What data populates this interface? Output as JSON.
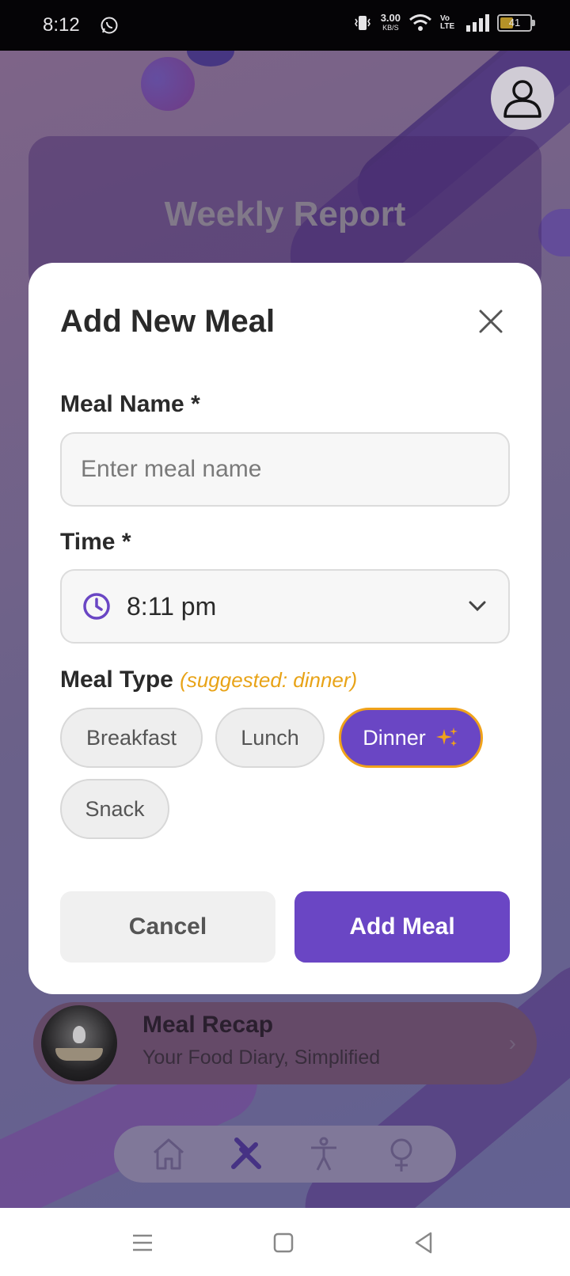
{
  "status_bar": {
    "time": "8:12",
    "net_speed": "3.00",
    "net_unit": "KB/S",
    "volte": "Vo LTE",
    "battery": "41",
    "icons": [
      "whatsapp-icon",
      "vibrate-icon",
      "wifi-icon",
      "signal-icon",
      "battery-icon"
    ]
  },
  "background": {
    "report_title": "Weekly Report",
    "recap": {
      "title": "Meal Recap",
      "subtitle": "Your Food Diary, Simplified"
    },
    "nav_icons": [
      "home-icon",
      "utensils-icon",
      "activity-icon",
      "female-icon"
    ]
  },
  "modal": {
    "title": "Add New Meal",
    "meal_name": {
      "label": "Meal Name *",
      "placeholder": "Enter meal name",
      "value": ""
    },
    "time": {
      "label": "Time *",
      "value": "8:11 pm"
    },
    "meal_type": {
      "label": "Meal Type",
      "hint": "(suggested: dinner)",
      "options": [
        "Breakfast",
        "Lunch",
        "Dinner",
        "Snack"
      ],
      "selected": "Dinner"
    },
    "cancel_label": "Cancel",
    "submit_label": "Add Meal"
  },
  "colors": {
    "accent": "#6a46c4",
    "highlight": "#f0a21a",
    "hint": "#e8a317"
  }
}
